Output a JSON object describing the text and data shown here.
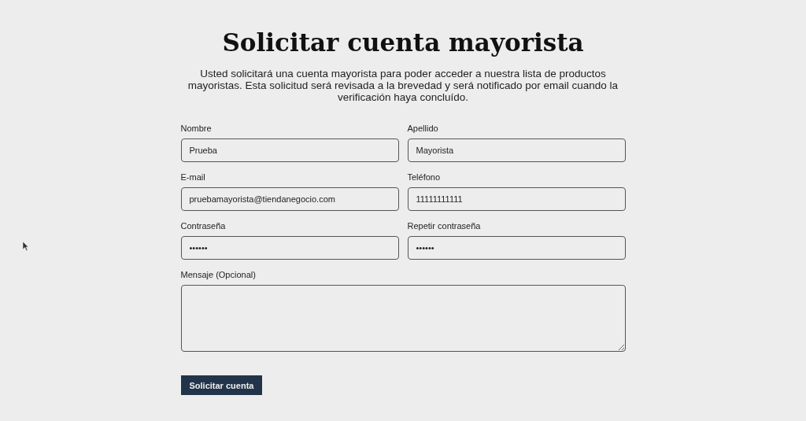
{
  "title": "Solicitar cuenta mayorista",
  "intro": "Usted solicitará una cuenta mayorista para poder acceder a nuestra lista de productos mayoristas. Esta solicitud será revisada a la brevedad y será notificado por email cuando la verificación haya concluído.",
  "fields": [
    {
      "label": "Nombre",
      "value": "Prueba"
    },
    {
      "label": "Apellido",
      "value": "Mayorista"
    },
    {
      "label": "E-mail",
      "value": "pruebamayorista@tiendanegocio.com"
    },
    {
      "label": "Teléfono",
      "value": "11111111111"
    },
    {
      "label": "Contraseña",
      "value": "••••••"
    },
    {
      "label": "Repetir contraseña",
      "value": "••••••"
    }
  ],
  "message": {
    "label": "Mensaje (Opcional)"
  },
  "submit": "Solicitar cuenta"
}
